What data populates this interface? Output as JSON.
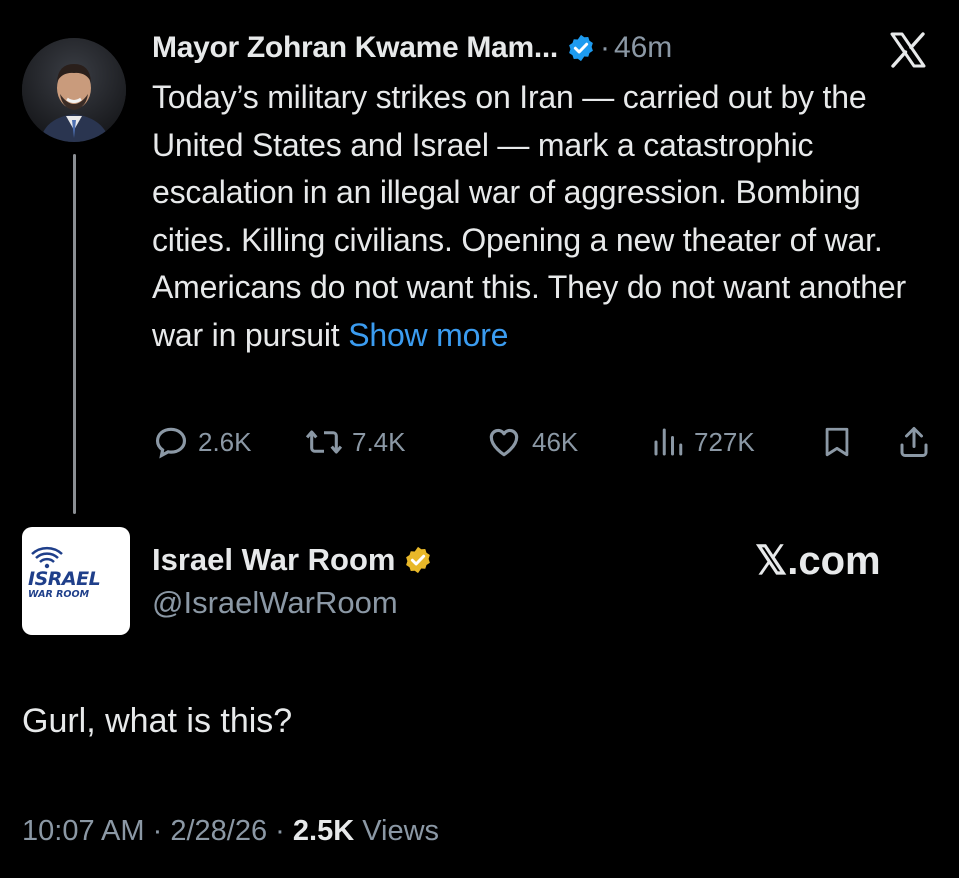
{
  "quoted_tweet": {
    "author_name": "Mayor Zohran Kwame Mam...",
    "separator": "·",
    "time": "46m",
    "body": "Today’s military strikes on Iran — carried out by the United States and Israel — mark a catastrophic escalation in an illegal war of aggression. Bombing cities. Killing civilians. Opening a new theater of war.  Americans do not want this. They do not want another war in pursuit",
    "show_more": "Show more",
    "replies": "2.6K",
    "reposts": "7.4K",
    "likes": "46K",
    "views": "727K",
    "icons": [
      "verified-badge-icon",
      "x-logo-icon",
      "reply-icon",
      "repost-icon",
      "like-icon",
      "views-icon",
      "bookmark-icon",
      "share-icon"
    ]
  },
  "main_tweet": {
    "author_name": "Israel War Room",
    "handle": "@IsraelWarRoom",
    "logo_text_top": "ISRAEL",
    "logo_text_bottom": "WAR ROOM",
    "brand": "𝕏.com",
    "text": "Gurl, what is this?",
    "time": "10:07 AM",
    "sep1": "·",
    "date": "2/28/26",
    "sep2": "·",
    "views_count": "2.5K",
    "views_label": "Views"
  },
  "colors": {
    "background": "#000000",
    "text": "#e7e9ea",
    "muted": "#8b98a5",
    "link": "#3b9cf0",
    "verified_blue": "#1d9bf0",
    "verified_gold": "#e8b829"
  }
}
